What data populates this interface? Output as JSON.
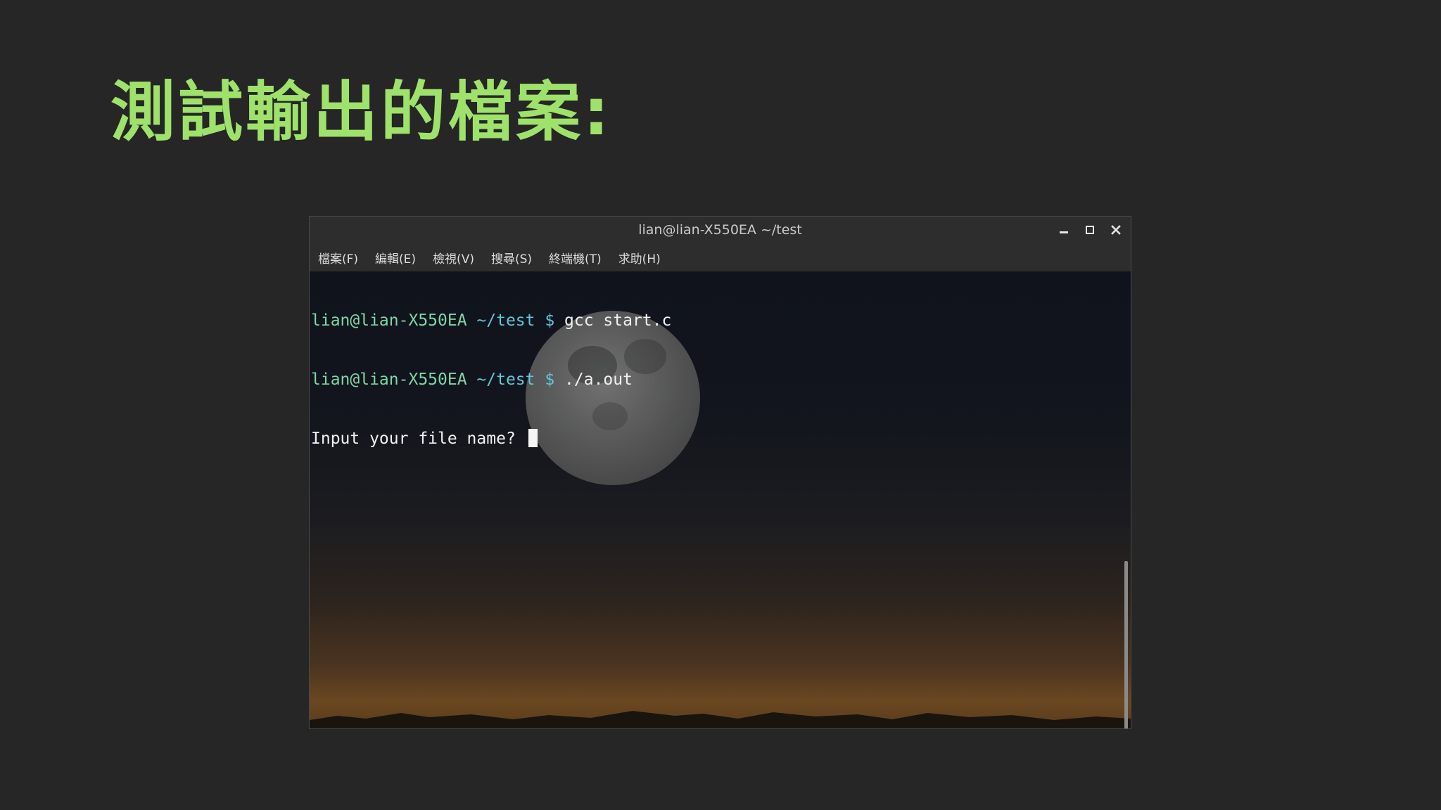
{
  "slide": {
    "title": "測試輸出的檔案:",
    "title_color": "#9ee26b",
    "background_color": "#262626"
  },
  "window": {
    "title": "lian@lian-X550EA ~/test",
    "controls": {
      "minimize_icon": "minimize-icon",
      "maximize_icon": "maximize-icon",
      "close_icon": "close-icon"
    }
  },
  "menu": {
    "items": [
      {
        "label": "檔案(F)"
      },
      {
        "label": "編輯(E)"
      },
      {
        "label": "檢視(V)"
      },
      {
        "label": "搜尋(S)"
      },
      {
        "label": "終端機(T)"
      },
      {
        "label": "求助(H)"
      }
    ]
  },
  "terminal": {
    "colors": {
      "prompt_user": "#7fd6a6",
      "prompt_path": "#5fc7d8",
      "text": "#f0f0f0"
    },
    "lines": [
      {
        "user": "lian@lian-X550EA",
        "path": " ~/test $ ",
        "command": "gcc start.c"
      },
      {
        "user": "lian@lian-X550EA",
        "path": " ~/test $ ",
        "command": "./a.out"
      }
    ],
    "output": "Input your file name? ",
    "wallpaper": "moon-night-sky"
  }
}
